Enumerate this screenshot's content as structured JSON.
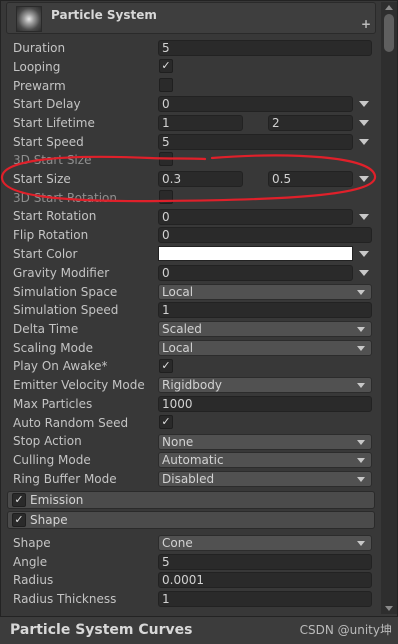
{
  "header": {
    "title": "Particle System",
    "plus": "+"
  },
  "props": {
    "duration": {
      "label": "Duration",
      "value": "5"
    },
    "looping": {
      "label": "Looping",
      "checked": "✓"
    },
    "prewarm": {
      "label": "Prewarm",
      "checked": ""
    },
    "start_delay": {
      "label": "Start Delay",
      "value": "0"
    },
    "start_lifetime": {
      "label": "Start Lifetime",
      "min": "1",
      "max": "2"
    },
    "start_speed": {
      "label": "Start Speed",
      "value": "5"
    },
    "start_size_3d": {
      "label": "3D Start Size",
      "checked": ""
    },
    "start_size": {
      "label": "Start Size",
      "min": "0.3",
      "max": "0.5"
    },
    "start_rotation_3d": {
      "label": "3D Start Rotation",
      "checked": ""
    },
    "start_rotation": {
      "label": "Start Rotation",
      "value": "0"
    },
    "flip_rotation": {
      "label": "Flip Rotation",
      "value": "0"
    },
    "start_color": {
      "label": "Start Color",
      "value": "#ffffff"
    },
    "gravity_modifier": {
      "label": "Gravity Modifier",
      "value": "0"
    },
    "simulation_space": {
      "label": "Simulation Space",
      "value": "Local"
    },
    "simulation_speed": {
      "label": "Simulation Speed",
      "value": "1"
    },
    "delta_time": {
      "label": "Delta Time",
      "value": "Scaled"
    },
    "scaling_mode": {
      "label": "Scaling Mode",
      "value": "Local"
    },
    "play_on_awake": {
      "label": "Play On Awake*",
      "checked": "✓"
    },
    "emitter_velocity_mode": {
      "label": "Emitter Velocity Mode",
      "value": "Rigidbody"
    },
    "max_particles": {
      "label": "Max Particles",
      "value": "1000"
    },
    "auto_random_seed": {
      "label": "Auto Random Seed",
      "checked": "✓"
    },
    "stop_action": {
      "label": "Stop Action",
      "value": "None"
    },
    "culling_mode": {
      "label": "Culling Mode",
      "value": "Automatic"
    },
    "ring_buffer_mode": {
      "label": "Ring Buffer Mode",
      "value": "Disabled"
    }
  },
  "modules": {
    "emission": {
      "label": "Emission",
      "checked": "✓"
    },
    "shape": {
      "label": "Shape",
      "checked": "✓"
    }
  },
  "shape_props": {
    "shape": {
      "label": "Shape",
      "value": "Cone"
    },
    "angle": {
      "label": "Angle",
      "value": "5"
    },
    "radius": {
      "label": "Radius",
      "value": "0.0001"
    },
    "radius_thickness": {
      "label": "Radius Thickness",
      "value": "1"
    }
  },
  "footer": {
    "title": "Particle System Curves",
    "watermark": "CSDN @unity坤"
  },
  "colors": {
    "annotation": "#e0202a",
    "background": "#383838",
    "field": "#2a2a2a",
    "dropdown": "#515151"
  }
}
